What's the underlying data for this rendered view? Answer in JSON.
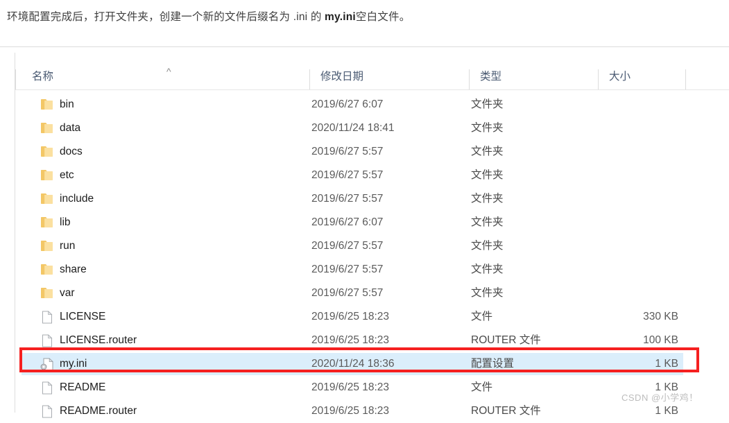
{
  "intro": {
    "before": "环境配置完成后，打开文件夹，创建一个新的文件后缀名为 .ini 的 ",
    "bold": "my.ini",
    "after": "空白文件。"
  },
  "explorer": {
    "columns": [
      {
        "key": "name",
        "label": "名称"
      },
      {
        "key": "date",
        "label": "修改日期"
      },
      {
        "key": "type",
        "label": "类型"
      },
      {
        "key": "size",
        "label": "大小"
      }
    ],
    "sort": {
      "column": "名称",
      "direction": "ascending",
      "glyph": "^"
    },
    "selection_color": "#dbeefb",
    "annotation_color": "#f52020",
    "rows": [
      {
        "icon": "folder-icon",
        "name": "bin",
        "date": "2019/6/27 6:07",
        "type": "文件夹",
        "size": "",
        "selected": false
      },
      {
        "icon": "folder-icon",
        "name": "data",
        "date": "2020/11/24 18:41",
        "type": "文件夹",
        "size": "",
        "selected": false
      },
      {
        "icon": "folder-icon",
        "name": "docs",
        "date": "2019/6/27 5:57",
        "type": "文件夹",
        "size": "",
        "selected": false
      },
      {
        "icon": "folder-icon",
        "name": "etc",
        "date": "2019/6/27 5:57",
        "type": "文件夹",
        "size": "",
        "selected": false
      },
      {
        "icon": "folder-icon",
        "name": "include",
        "date": "2019/6/27 5:57",
        "type": "文件夹",
        "size": "",
        "selected": false
      },
      {
        "icon": "folder-icon",
        "name": "lib",
        "date": "2019/6/27 6:07",
        "type": "文件夹",
        "size": "",
        "selected": false
      },
      {
        "icon": "folder-icon",
        "name": "run",
        "date": "2019/6/27 5:57",
        "type": "文件夹",
        "size": "",
        "selected": false
      },
      {
        "icon": "folder-icon",
        "name": "share",
        "date": "2019/6/27 5:57",
        "type": "文件夹",
        "size": "",
        "selected": false
      },
      {
        "icon": "folder-icon",
        "name": "var",
        "date": "2019/6/27 5:57",
        "type": "文件夹",
        "size": "",
        "selected": false
      },
      {
        "icon": "file-icon",
        "name": "LICENSE",
        "date": "2019/6/25 18:23",
        "type": "文件",
        "size": "330 KB",
        "selected": false
      },
      {
        "icon": "file-icon",
        "name": "LICENSE.router",
        "date": "2019/6/25 18:23",
        "type": "ROUTER 文件",
        "size": "100 KB",
        "selected": false
      },
      {
        "icon": "config-file-icon",
        "name": "my.ini",
        "date": "2020/11/24 18:36",
        "type": "配置设置",
        "size": "1 KB",
        "selected": true
      },
      {
        "icon": "file-icon",
        "name": "README",
        "date": "2019/6/25 18:23",
        "type": "文件",
        "size": "1 KB",
        "selected": false
      },
      {
        "icon": "file-icon",
        "name": "README.router",
        "date": "2019/6/25 18:23",
        "type": "ROUTER 文件",
        "size": "1 KB",
        "selected": false
      }
    ]
  },
  "watermark": {
    "text": "CSDN @小学鸡！"
  }
}
